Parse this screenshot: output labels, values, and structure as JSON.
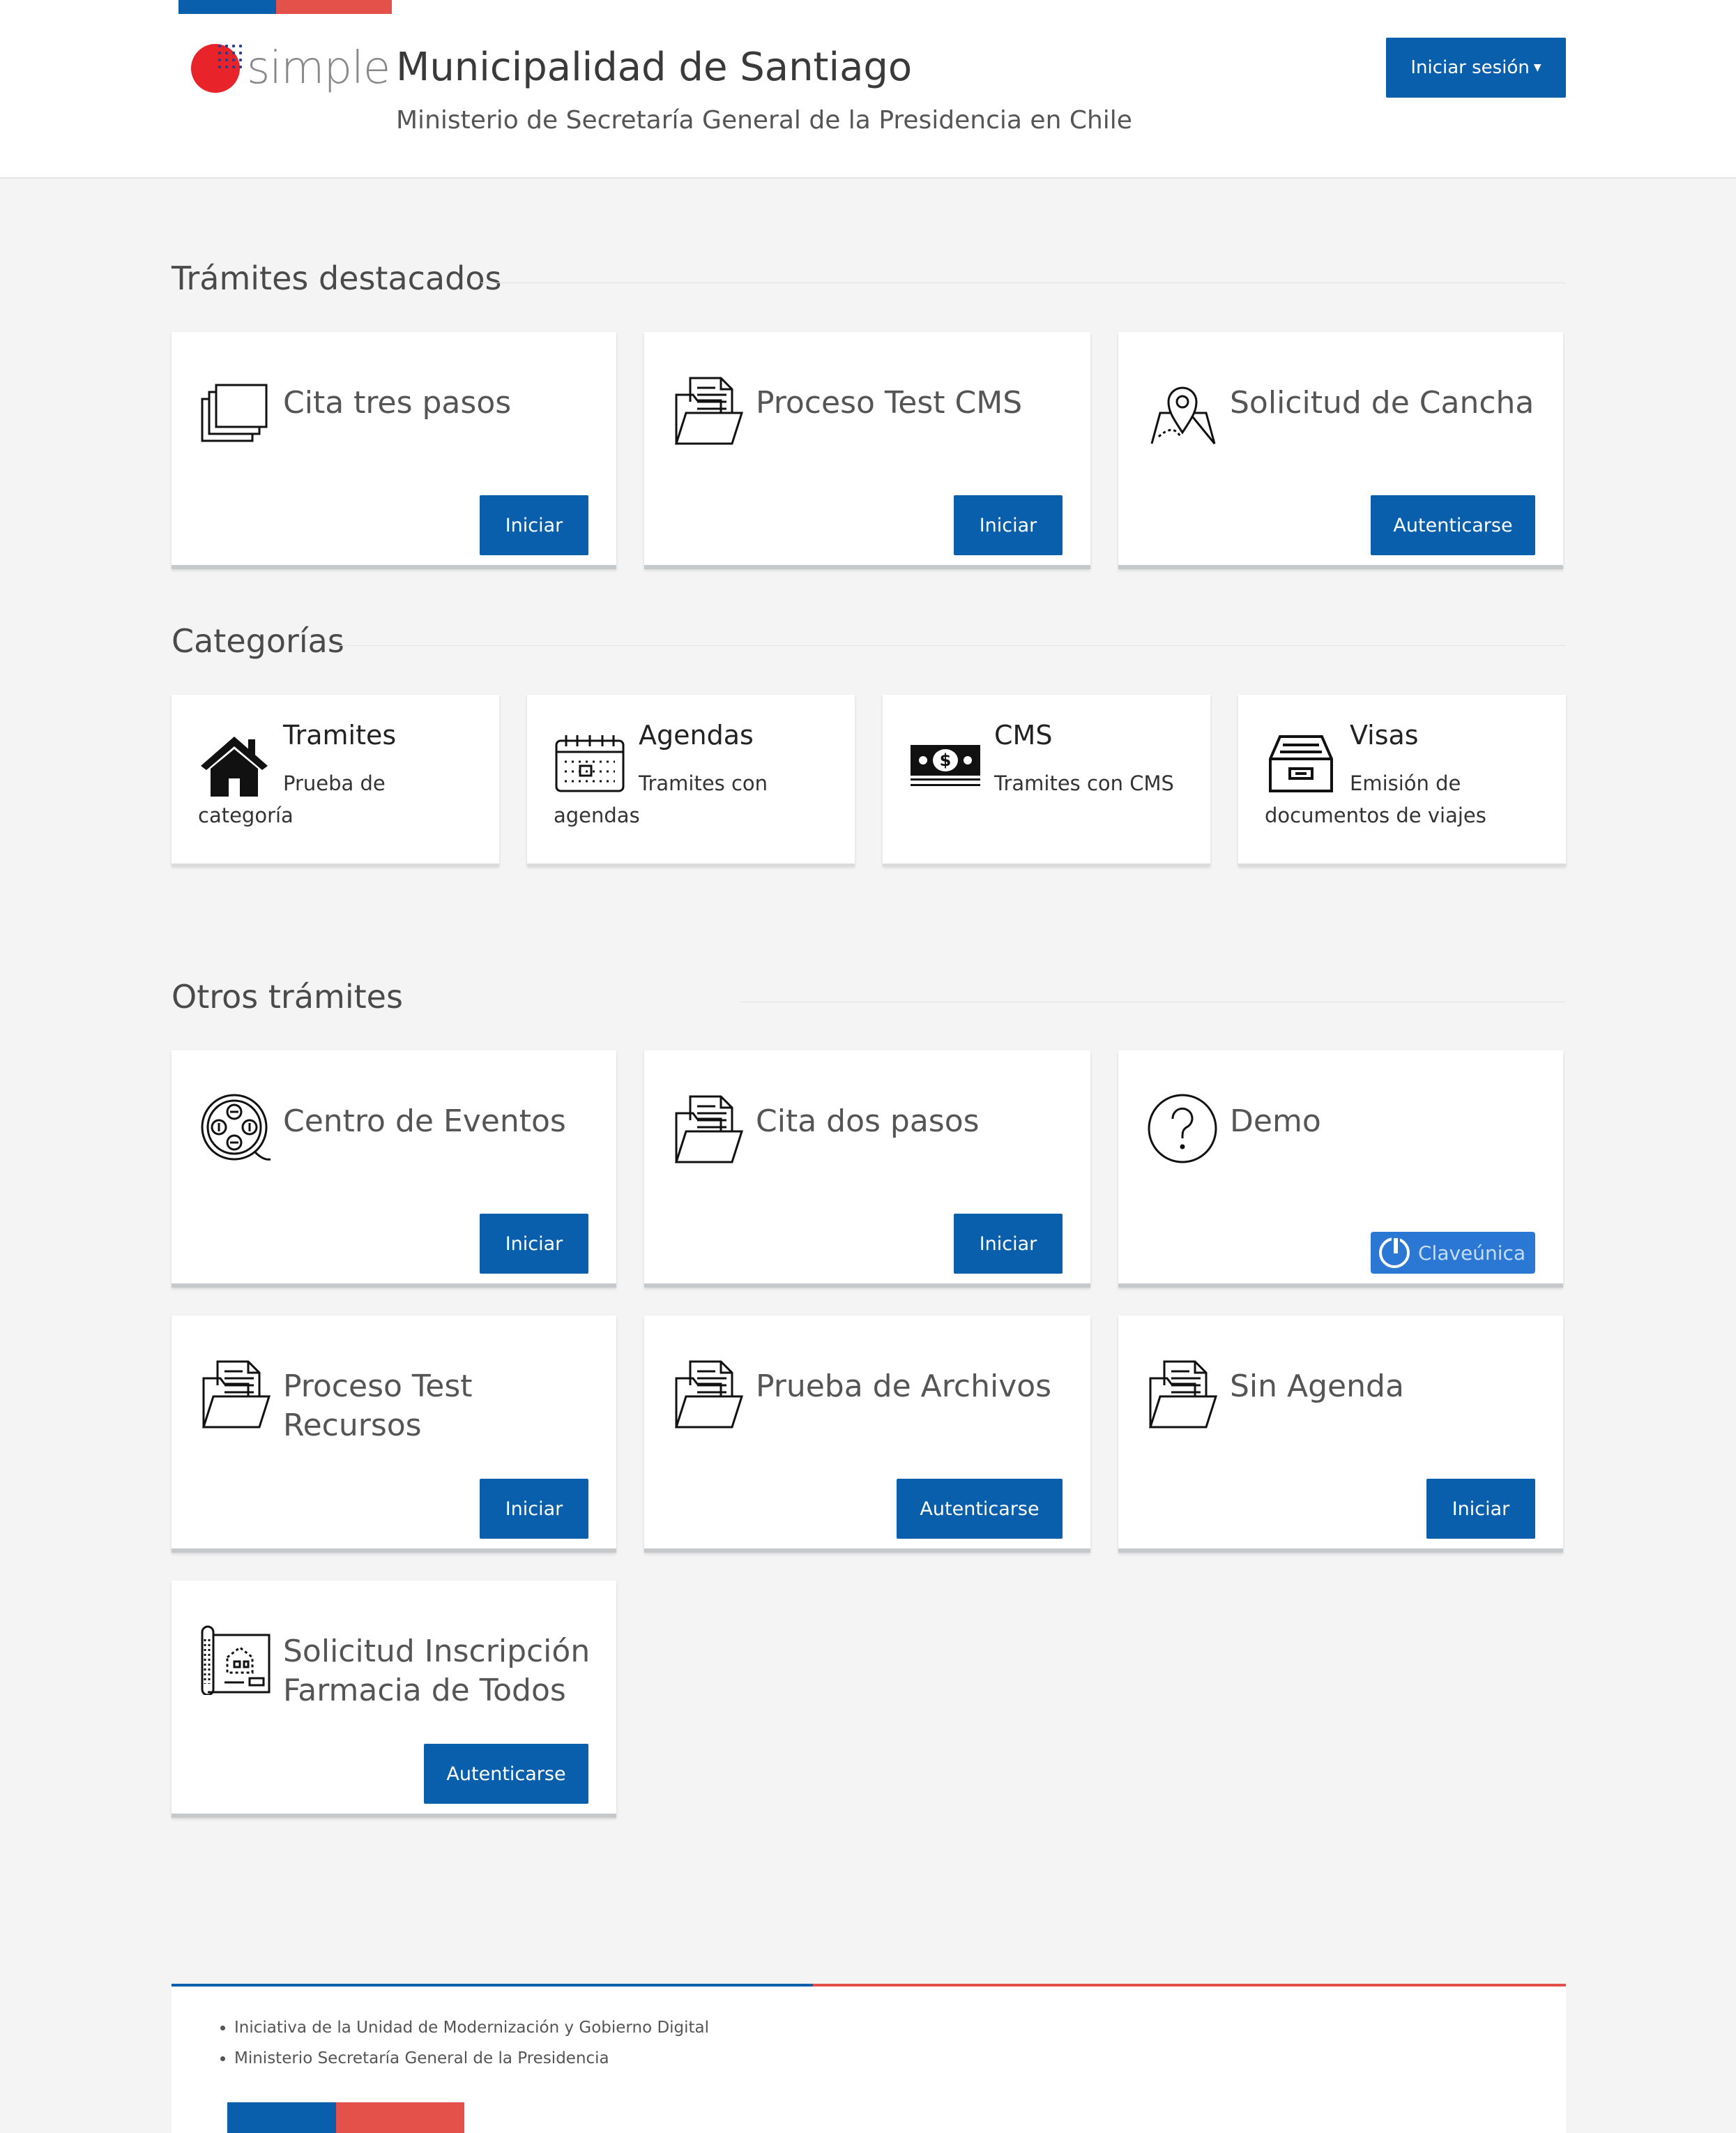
{
  "header": {
    "logo_text": "simple",
    "title": "Municipalidad de Santiago",
    "subtitle": "Ministerio de Secretaría General de la Presidencia en Chile",
    "login_label": "Iniciar sesión"
  },
  "featured": {
    "title": "Trámites destacados",
    "cards": [
      {
        "title": "Cita tres pasos",
        "icon": "stacked-pages-icon",
        "button": "Iniciar"
      },
      {
        "title": "Proceso Test CMS",
        "icon": "folder-document-icon",
        "button": "Iniciar"
      },
      {
        "title": "Solicitud de Cancha",
        "icon": "map-pin-icon",
        "button": "Autenticarse"
      }
    ]
  },
  "categories": {
    "title": "Categorías",
    "items": [
      {
        "name": "Tramites",
        "description": "Prueba de categoría",
        "icon": "house-icon"
      },
      {
        "name": "Agendas",
        "description": "Tramites con agendas",
        "icon": "calendar-icon"
      },
      {
        "name": "CMS",
        "description": "Tramites con CMS",
        "icon": "money-icon"
      },
      {
        "name": "Visas",
        "description": "Emisión de documentos de viajes",
        "icon": "inbox-tray-icon"
      }
    ]
  },
  "others": {
    "title": "Otros trámites",
    "cards": [
      {
        "title": "Centro de Eventos",
        "icon": "film-reel-icon",
        "button": "Iniciar"
      },
      {
        "title": "Cita dos pasos",
        "icon": "folder-document-icon",
        "button": "Iniciar"
      },
      {
        "title": "Demo",
        "icon": "question-icon",
        "button": "Claveúnica"
      },
      {
        "title": "Proceso Test Recursos",
        "icon": "folder-document-icon",
        "button": "Iniciar"
      },
      {
        "title": "Prueba de Archivos",
        "icon": "folder-document-icon",
        "button": "Autenticarse"
      },
      {
        "title": "Sin Agenda",
        "icon": "folder-document-icon",
        "button": "Iniciar"
      },
      {
        "title_line1": "Solicitud Inscripción",
        "title_line2": "Farmacia de Todos",
        "icon": "blueprint-icon",
        "button": "Autenticarse"
      }
    ]
  },
  "footer": {
    "links": [
      "Iniciativa de la Unidad de Modernización y Gobierno Digital",
      "Ministerio Secretaría General de la Presidencia"
    ]
  },
  "colors": {
    "primary": "#0a5fac",
    "flag_red": "#e4504a",
    "clave_blue": "#2a77d4"
  }
}
